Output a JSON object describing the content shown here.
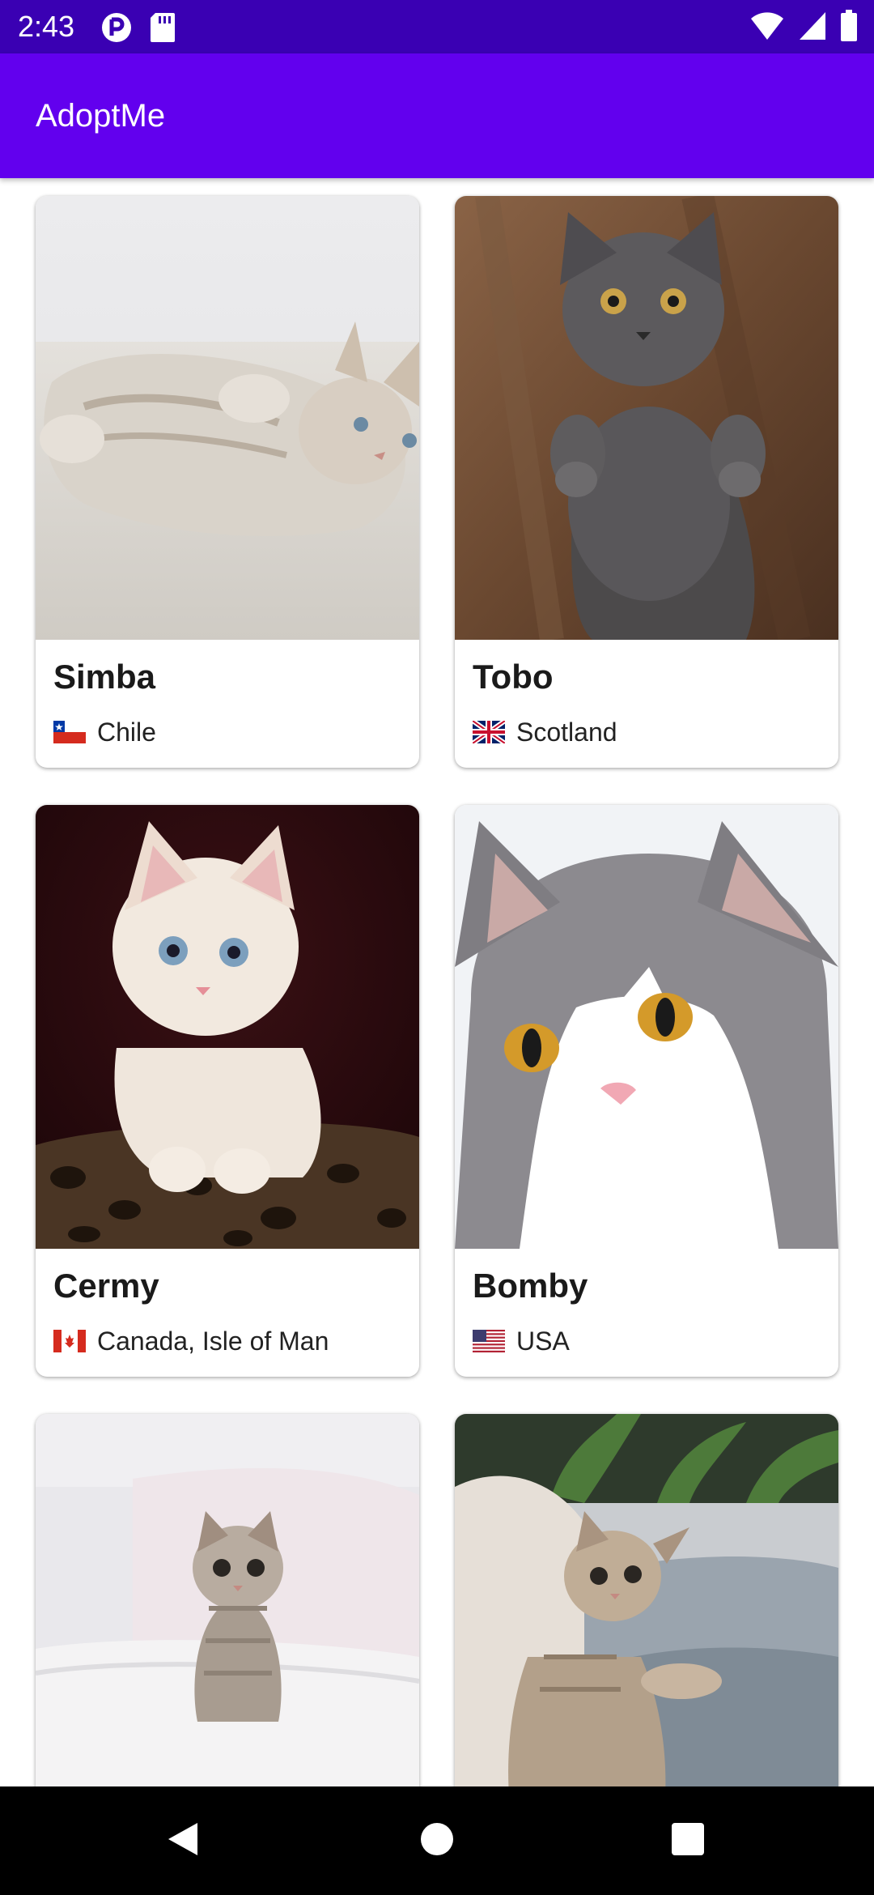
{
  "status_bar": {
    "time": "2:43",
    "left_icons": [
      "privacy-indicator-icon",
      "sd-card-icon"
    ],
    "right_icons": [
      "wifi-icon",
      "cellular-signal-icon",
      "battery-icon"
    ]
  },
  "app_bar": {
    "title": "AdoptMe",
    "color": "#6200ee"
  },
  "pets": [
    {
      "name": "Simba",
      "country": "Chile",
      "flag": "chile-flag-icon"
    },
    {
      "name": "Tobo",
      "country": "Scotland",
      "flag": "uk-flag-icon"
    },
    {
      "name": "Cermy",
      "country": "Canada, Isle of Man",
      "flag": "canada-flag-icon"
    },
    {
      "name": "Bomby",
      "country": "USA",
      "flag": "usa-flag-icon"
    },
    {
      "name": "",
      "country": "",
      "flag": ""
    },
    {
      "name": "",
      "country": "",
      "flag": ""
    }
  ],
  "nav_bar": {
    "buttons": [
      "back-icon",
      "home-icon",
      "recents-icon"
    ]
  }
}
